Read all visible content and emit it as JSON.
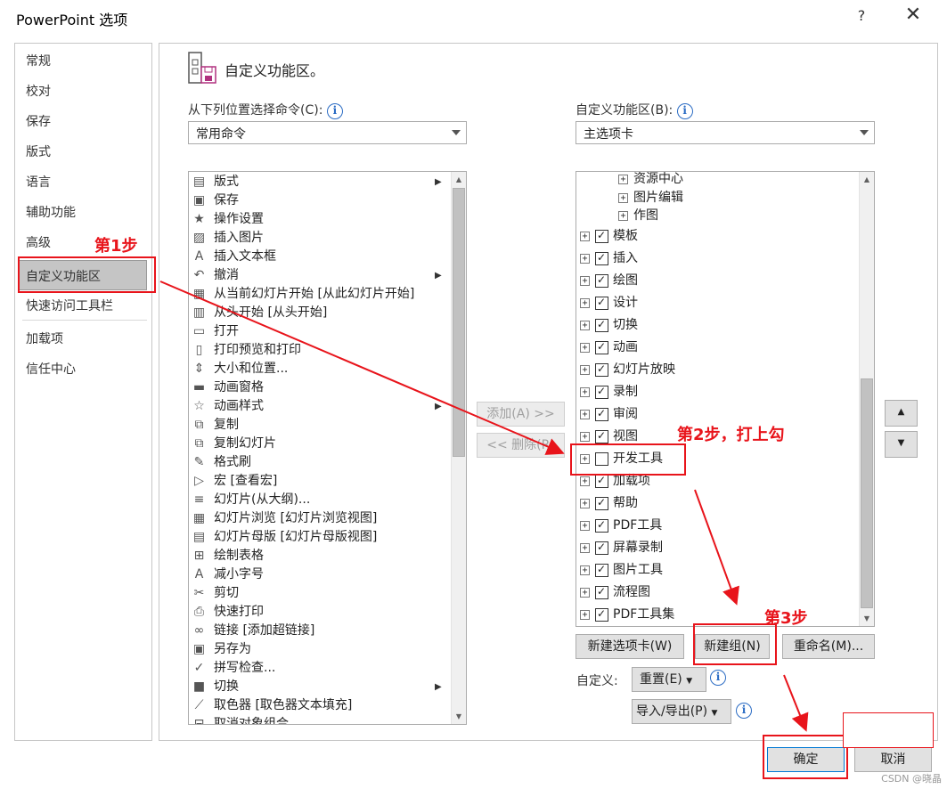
{
  "window": {
    "title": "PowerPoint 选项",
    "help": "?",
    "close": "✕"
  },
  "sidebar": {
    "items": [
      {
        "label": "常规"
      },
      {
        "label": "校对"
      },
      {
        "label": "保存"
      },
      {
        "label": "版式"
      },
      {
        "label": "语言"
      },
      {
        "label": "辅助功能"
      },
      {
        "label": "高级"
      },
      {
        "label": "自定义功能区"
      },
      {
        "label": "快速访问工具栏"
      },
      {
        "label": "加载项"
      },
      {
        "label": "信任中心"
      }
    ]
  },
  "header": {
    "title": "自定义功能区。"
  },
  "left": {
    "label": "从下列位置选择命令(C):",
    "combo_value": "常用命令",
    "commands": [
      {
        "icon": "layout-icon",
        "label": "版式",
        "sub": "▶"
      },
      {
        "icon": "save-icon",
        "label": "保存",
        "sub": ""
      },
      {
        "icon": "action-settings-icon",
        "label": "操作设置",
        "sub": ""
      },
      {
        "icon": "insert-picture-icon",
        "label": "插入图片",
        "sub": ""
      },
      {
        "icon": "textbox-icon",
        "label": "插入文本框",
        "sub": ""
      },
      {
        "icon": "undo-icon",
        "label": "撤消",
        "sub": "▶"
      },
      {
        "icon": "slideshow-current-icon",
        "label": "从当前幻灯片开始 [从此幻灯片开始]",
        "sub": ""
      },
      {
        "icon": "slideshow-start-icon",
        "label": "从头开始 [从头开始]",
        "sub": ""
      },
      {
        "icon": "open-icon",
        "label": "打开",
        "sub": ""
      },
      {
        "icon": "print-preview-icon",
        "label": "打印预览和打印",
        "sub": ""
      },
      {
        "icon": "size-position-icon",
        "label": "大小和位置...",
        "sub": ""
      },
      {
        "icon": "animation-pane-icon",
        "label": "动画窗格",
        "sub": ""
      },
      {
        "icon": "animation-style-icon",
        "label": "动画样式",
        "sub": "▶"
      },
      {
        "icon": "copy-icon",
        "label": "复制",
        "sub": ""
      },
      {
        "icon": "duplicate-slide-icon",
        "label": "复制幻灯片",
        "sub": ""
      },
      {
        "icon": "format-painter-icon",
        "label": "格式刷",
        "sub": ""
      },
      {
        "icon": "macro-icon",
        "label": "宏 [查看宏]",
        "sub": ""
      },
      {
        "icon": "slides-outline-icon",
        "label": "幻灯片(从大纲)...",
        "sub": ""
      },
      {
        "icon": "slide-sorter-icon",
        "label": "幻灯片浏览 [幻灯片浏览视图]",
        "sub": ""
      },
      {
        "icon": "slide-master-icon",
        "label": "幻灯片母版 [幻灯片母版视图]",
        "sub": ""
      },
      {
        "icon": "draw-table-icon",
        "label": "绘制表格",
        "sub": ""
      },
      {
        "icon": "decrease-font-icon",
        "label": "减小字号",
        "sub": ""
      },
      {
        "icon": "cut-icon",
        "label": "剪切",
        "sub": ""
      },
      {
        "icon": "quick-print-icon",
        "label": "快速打印",
        "sub": ""
      },
      {
        "icon": "link-icon",
        "label": "链接 [添加超链接]",
        "sub": ""
      },
      {
        "icon": "save-as-icon",
        "label": "另存为",
        "sub": ""
      },
      {
        "icon": "spelling-icon",
        "label": "拼写检查...",
        "sub": ""
      },
      {
        "icon": "switch-icon",
        "label": "切换",
        "sub": "▶"
      },
      {
        "icon": "eyedropper-icon",
        "label": "取色器 [取色器文本填充]",
        "sub": ""
      },
      {
        "icon": "ungroup-icon",
        "label": "取消对象组合",
        "sub": ""
      }
    ]
  },
  "middle": {
    "add": "添加(A) >>",
    "remove": "<< 删除(R)"
  },
  "right": {
    "label": "自定义功能区(B):",
    "combo_value": "主选项卡",
    "subitems": [
      {
        "label": "资源中心"
      },
      {
        "label": "图片编辑"
      },
      {
        "label": "作图"
      }
    ],
    "tabs": [
      {
        "label": "模板",
        "checked": "☑"
      },
      {
        "label": "插入",
        "checked": "☑"
      },
      {
        "label": "绘图",
        "checked": "☑"
      },
      {
        "label": "设计",
        "checked": "☑"
      },
      {
        "label": "切换",
        "checked": "☑"
      },
      {
        "label": "动画",
        "checked": "☑"
      },
      {
        "label": "幻灯片放映",
        "checked": "☑"
      },
      {
        "label": "录制",
        "checked": "☑"
      },
      {
        "label": "审阅",
        "checked": "☑"
      },
      {
        "label": "视图",
        "checked": "☑"
      },
      {
        "label": "开发工具",
        "checked": "☐"
      },
      {
        "label": "加载项",
        "checked": "☑"
      },
      {
        "label": "帮助",
        "checked": "☑"
      },
      {
        "label": "PDF工具",
        "checked": "☑"
      },
      {
        "label": "屏幕录制",
        "checked": "☑"
      },
      {
        "label": "图片工具",
        "checked": "☑"
      },
      {
        "label": "流程图",
        "checked": "☑"
      },
      {
        "label": "PDF工具集",
        "checked": "☑"
      }
    ],
    "new_tab": "新建选项卡(W)",
    "new_group": "新建组(N)",
    "rename": "重命名(M)...",
    "custom_label": "自定义:",
    "reset": "重置(E)",
    "import_export": "导入/导出(P)"
  },
  "footer": {
    "ok": "确定",
    "cancel": "取消",
    "watermark": "CSDN @晓晶"
  },
  "annotations": {
    "step1": "第1步",
    "step2": "第2步，打上勾",
    "step3": "第3步",
    "color": "#e8141b"
  }
}
